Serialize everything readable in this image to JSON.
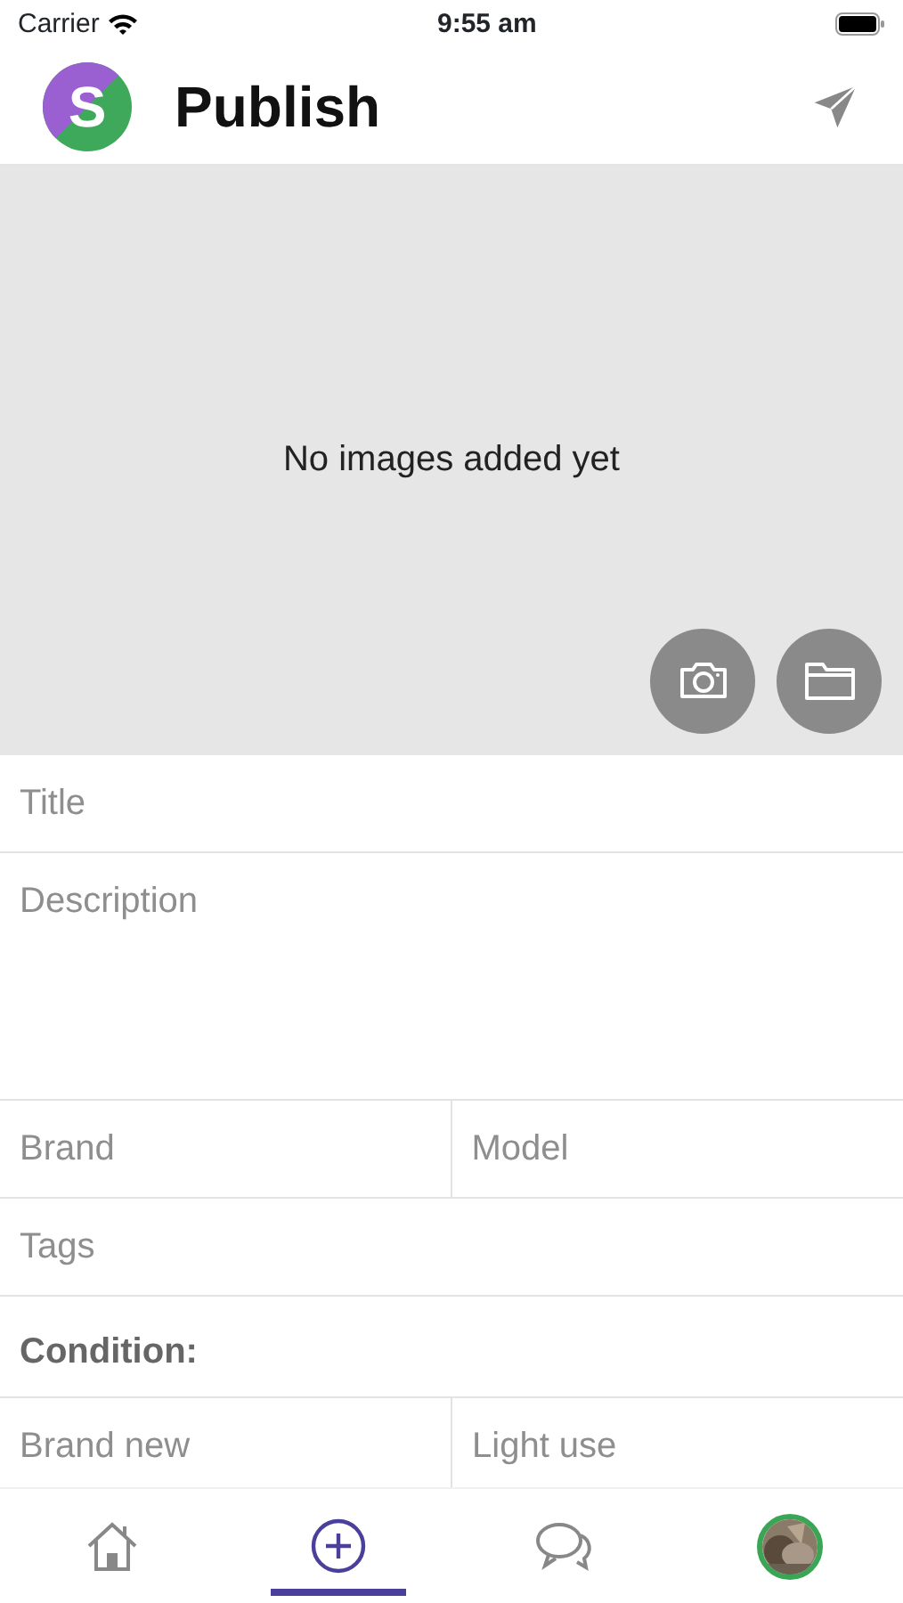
{
  "status_bar": {
    "carrier": "Carrier",
    "time": "9:55 am"
  },
  "header": {
    "logo_letter": "S",
    "title": "Publish"
  },
  "images": {
    "empty_text": "No images added yet"
  },
  "form": {
    "title": {
      "placeholder": "Title"
    },
    "description": {
      "placeholder": "Description"
    },
    "brand": {
      "placeholder": "Brand"
    },
    "model": {
      "placeholder": "Model"
    },
    "tags": {
      "placeholder": "Tags"
    }
  },
  "condition": {
    "label": "Condition:",
    "options": [
      {
        "label": "Brand new"
      },
      {
        "label": "Light use"
      }
    ]
  },
  "tabs": [
    {
      "kind": "home",
      "selected": false
    },
    {
      "kind": "add",
      "selected": true
    },
    {
      "kind": "chat",
      "selected": false
    },
    {
      "kind": "profile",
      "selected": false
    }
  ]
}
